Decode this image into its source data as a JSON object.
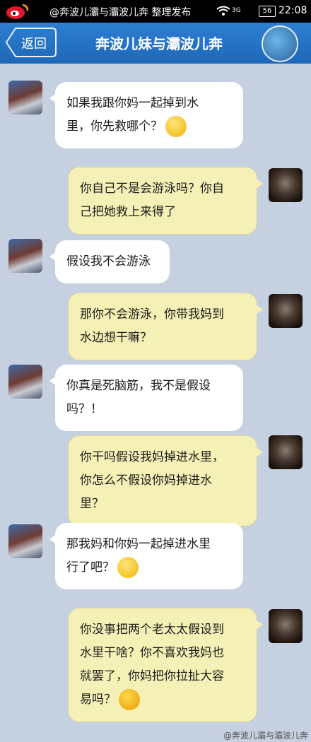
{
  "status_bar": {
    "credit": "@奔波儿灞与灞波儿奔 整理发布",
    "signal": "3G",
    "battery": "56",
    "time": "22:08"
  },
  "header": {
    "back_label": "返回",
    "title": "奔波儿妹与灞波儿奔"
  },
  "messages": [
    {
      "side": "in",
      "lines": [
        "如果我跟你妈一起掉到水",
        "里，你先救哪个？"
      ],
      "emoji": "worried-face-emoji"
    },
    {
      "side": "out",
      "lines": [
        "你自己不是会游泳吗？你自",
        "己把她救上来得了"
      ]
    },
    {
      "side": "in",
      "lines": [
        "假设我不会游泳"
      ]
    },
    {
      "side": "out",
      "lines": [
        "那你不会游泳，你带我妈到",
        "水边想干嘛？"
      ]
    },
    {
      "side": "in",
      "lines": [
        "你真是死脑筋，我不是假设",
        "吗？！"
      ]
    },
    {
      "side": "out",
      "lines": [
        "你干吗假设我妈掉进水里，",
        "你怎么不假设你妈掉进水",
        "里？"
      ]
    },
    {
      "side": "in",
      "lines": [
        "那我妈和你妈一起掉进水里",
        "行了吧？"
      ],
      "emoji": "sweat-face-emoji"
    },
    {
      "side": "out",
      "lines": [
        "你没事把两个老太太假设到",
        "水里干啥？你不喜欢我妈也",
        "就罢了，你妈把你拉扯大容",
        "易吗？"
      ],
      "emoji": "tongue-face-emoji"
    }
  ],
  "watermark": "@奔波儿灞与灞波儿奔"
}
